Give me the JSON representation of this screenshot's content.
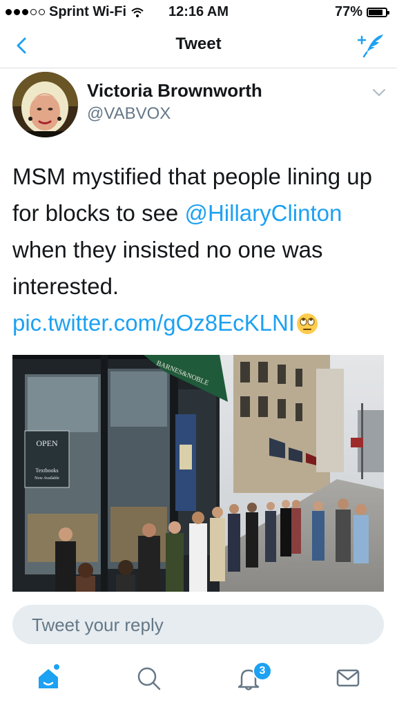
{
  "status_bar": {
    "carrier": "Sprint Wi-Fi",
    "time": "12:16 AM",
    "battery": "77%",
    "signal_filled_dots": 3,
    "signal_total_dots": 5
  },
  "nav": {
    "title": "Tweet",
    "back_icon": "chevron-left-icon",
    "compose_icon": "compose-tweet-icon"
  },
  "tweet": {
    "author_name": "Victoria Brownworth",
    "author_handle": "@VABVOX",
    "text_part1": "MSM mystified that people lining up for blocks to see ",
    "mention": "@HillaryClinton",
    "text_part2": " when they insisted no one was interested. ",
    "link": "pic.twitter.com/gOz8EcKLNI",
    "emoji": "eye-roll-emoji",
    "photo": {
      "store_sign": "BARNES&NOBLE",
      "window_sign_open": "OPEN",
      "window_sign_textbooks": "Textbooks",
      "window_sign_available": "Now Available"
    }
  },
  "reply": {
    "placeholder": "Tweet your reply"
  },
  "tabs": [
    {
      "name": "home",
      "icon": "home-icon",
      "active": true
    },
    {
      "name": "search",
      "icon": "search-icon",
      "active": false
    },
    {
      "name": "notifications",
      "icon": "bell-icon",
      "badge": "3",
      "active": false
    },
    {
      "name": "messages",
      "icon": "envelope-icon",
      "active": false
    }
  ],
  "colors": {
    "accent": "#1da1f2",
    "secondary_text": "#657786",
    "reply_bg": "#e6ecf0"
  }
}
